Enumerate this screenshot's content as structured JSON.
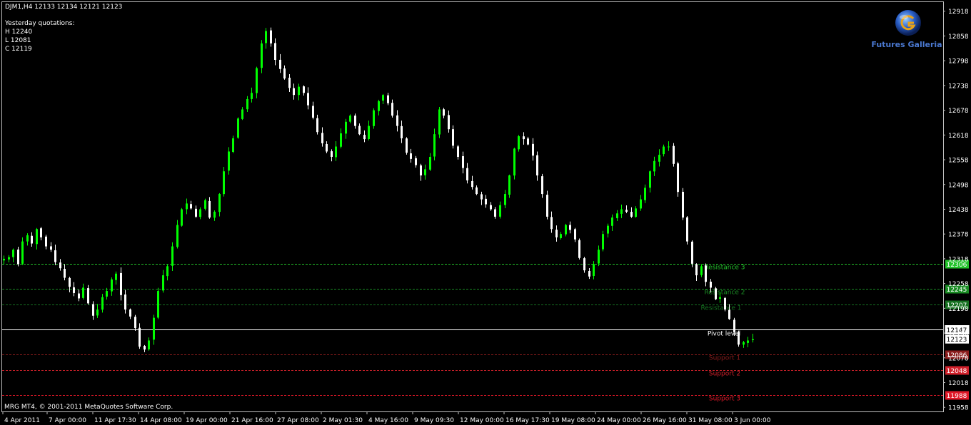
{
  "header": {
    "symbol_line": "DJM1,H4  12133 12134 12121 12123",
    "yesterday_title": "Yesterday quotations:",
    "high": "H 12240",
    "low": "L 12081",
    "close": "C 12119"
  },
  "footer": {
    "copyright": "MRG MT4, © 2001-2011 MetaQuotes Software Corp."
  },
  "logo": {
    "text": "Futures Galleria",
    "icon": "globe-g-logo-icon"
  },
  "colors": {
    "background": "#000000",
    "bull": "#00ff00",
    "bear": "#ffffff",
    "resistance_3": "#22c22a",
    "resistance_2": "#1a8c24",
    "resistance_1": "#157020",
    "pivot": "#ffffff",
    "support_1": "#8a1c1c",
    "support_2": "#d0202a",
    "support_3": "#e01828"
  },
  "chart_data": {
    "type": "candlestick",
    "y_axis_ticks": [
      12918,
      12858,
      12798,
      12738,
      12678,
      12618,
      12558,
      12498,
      12438,
      12378,
      12318,
      12258,
      12198,
      12138,
      12078,
      12018,
      11958
    ],
    "y_axis_labels": [
      "12918",
      "12858",
      "12798",
      "12738",
      "12678",
      "12618",
      "12558",
      "12498",
      "12438",
      "12378",
      "12306",
      "12258",
      "12225",
      "12195",
      "12147",
      "12123",
      "12078",
      "12086",
      "12048",
      "12018",
      "11988",
      "11958"
    ],
    "visible_tick_labels": [
      "12918",
      "12858",
      "12798",
      "12738",
      "12678",
      "12618",
      "12558",
      "12498",
      "12438",
      "12378",
      "12258",
      "12195",
      "12078",
      "12018",
      "11958"
    ],
    "ylim": [
      11948,
      12940
    ],
    "x_axis_labels": [
      "4 Apr 2011",
      "7 Apr 00:00",
      "11 Apr 17:30",
      "14 Apr 08:00",
      "19 Apr 00:00",
      "21 Apr 16:00",
      "27 Apr 08:00",
      "2 May 01:30",
      "4 May 16:00",
      "9 May 09:30",
      "12 May 00:00",
      "16 May 17:30",
      "19 May 08:00",
      "24 May 00:00",
      "26 May 16:00",
      "31 May 08:00",
      "3 Jun 00:00"
    ],
    "levels": [
      {
        "name": "Resistance 3",
        "value": 12306,
        "value_label": "12306",
        "color": "#22c22a",
        "style": "dashed"
      },
      {
        "name": "Resistance 2",
        "value": 12245,
        "value_label": "12245",
        "color": "#1a8c24",
        "style": "dashed"
      },
      {
        "name": "Resistance 1",
        "value": 12207,
        "value_label": "12207",
        "color": "#157020",
        "style": "dashed"
      },
      {
        "name": "Pivot level",
        "value": 12147,
        "value_label": "12147",
        "color": "#ffffff",
        "style": "solid"
      },
      {
        "name": "Support 1",
        "value": 12086,
        "value_label": "12086",
        "color": "#8a1c1c",
        "style": "dashed"
      },
      {
        "name": "Support 2",
        "value": 12048,
        "value_label": "12048",
        "color": "#d0202a",
        "style": "dashed"
      },
      {
        "name": "Support 3",
        "value": 11988,
        "value_label": "11988",
        "color": "#e01828",
        "style": "dashed"
      }
    ],
    "current_price": 12123,
    "current_price_label": "12123",
    "path": [
      12318,
      12322,
      12340,
      12305,
      12360,
      12375,
      12355,
      12390,
      12370,
      12348,
      12340,
      12310,
      12295,
      12272,
      12250,
      12235,
      12222,
      12248,
      12210,
      12180,
      12195,
      12225,
      12240,
      12268,
      12282,
      12230,
      12195,
      12178,
      12150,
      12105,
      12098,
      12120,
      12175,
      12240,
      12278,
      12300,
      12348,
      12400,
      12438,
      12452,
      12440,
      12420,
      12438,
      12460,
      12418,
      12432,
      12475,
      12530,
      12578,
      12610,
      12658,
      12680,
      12705,
      12720,
      12780,
      12840,
      12870,
      12840,
      12800,
      12778,
      12755,
      12732,
      12715,
      12735,
      12720,
      12690,
      12660,
      12625,
      12598,
      12578,
      12565,
      12590,
      12622,
      12650,
      12665,
      12640,
      12620,
      12608,
      12640,
      12678,
      12700,
      12715,
      12695,
      12665,
      12640,
      12610,
      12575,
      12560,
      12545,
      12520,
      12535,
      12565,
      12620,
      12680,
      12665,
      12632,
      12592,
      12565,
      12538,
      12508,
      12492,
      12475,
      12462,
      12450,
      12438,
      12420,
      12448,
      12475,
      12520,
      12585,
      12615,
      12608,
      12595,
      12568,
      12520,
      12475,
      12420,
      12390,
      12370,
      12378,
      12400,
      12388,
      12365,
      12320,
      12290,
      12275,
      12305,
      12340,
      12378,
      12398,
      12418,
      12428,
      12438,
      12432,
      12420,
      12440,
      12462,
      12490,
      12530,
      12555,
      12570,
      12590,
      12590,
      12548,
      12480,
      12418,
      12360,
      12306,
      12278,
      12300,
      12262,
      12248,
      12220,
      12225,
      12195,
      12172,
      12140,
      12110,
      12116,
      12120,
      12123
    ]
  }
}
